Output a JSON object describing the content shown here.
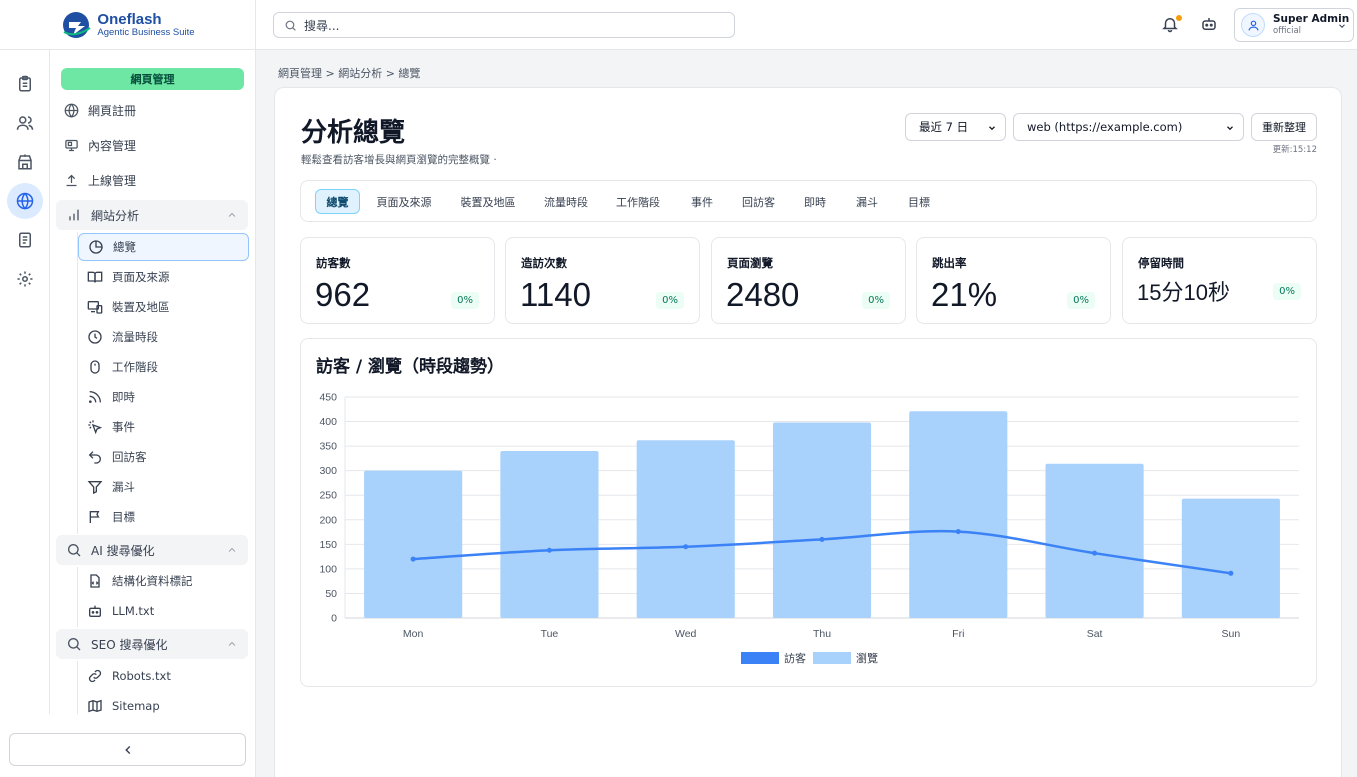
{
  "brand": {
    "name": "Oneflash",
    "tagline": "Agentic Business Suite"
  },
  "header": {
    "search_placeholder": "搜尋...",
    "user_name": "Super Admin",
    "user_role": "official"
  },
  "sidebar": {
    "top_button": "網頁管理",
    "items": [
      {
        "label": "網頁註冊",
        "icon": "globe-icon"
      },
      {
        "label": "內容管理",
        "icon": "monitor-icon"
      },
      {
        "label": "上線管理",
        "icon": "upload-icon"
      }
    ],
    "groups": [
      {
        "label": "網站分析",
        "icon": "bar-chart-icon",
        "children": [
          {
            "label": "總覽",
            "icon": "pie-chart-icon",
            "active": true
          },
          {
            "label": "頁面及來源",
            "icon": "book-icon"
          },
          {
            "label": "裝置及地區",
            "icon": "devices-icon"
          },
          {
            "label": "流量時段",
            "icon": "clock-icon"
          },
          {
            "label": "工作階段",
            "icon": "mouse-icon"
          },
          {
            "label": "即時",
            "icon": "rss-icon"
          },
          {
            "label": "事件",
            "icon": "pointer-icon"
          },
          {
            "label": "回訪客",
            "icon": "undo-icon"
          },
          {
            "label": "漏斗",
            "icon": "funnel-icon"
          },
          {
            "label": "目標",
            "icon": "flag-icon"
          }
        ]
      },
      {
        "label": "AI 搜尋優化",
        "icon": "search-icon",
        "children": [
          {
            "label": "結構化資料標記",
            "icon": "file-code-icon"
          },
          {
            "label": "LLM.txt",
            "icon": "bot-icon"
          }
        ]
      },
      {
        "label": "SEO 搜尋優化",
        "icon": "search-icon",
        "children": [
          {
            "label": "Robots.txt",
            "icon": "link-icon"
          },
          {
            "label": "Sitemap",
            "icon": "map-icon"
          }
        ]
      }
    ]
  },
  "main": {
    "breadcrumb": "網頁管理 > 網站分析 > 總覽",
    "title": "分析總覽",
    "subtitle": "輕鬆查看訪客增長與網頁瀏覽的完整概覽 ·",
    "range_select": "最近 7 日",
    "site_select": "web (https://example.com)",
    "refresh_label": "重新整理",
    "updated": "更新:15:12",
    "tabs": [
      "總覽",
      "頁面及來源",
      "裝置及地區",
      "流量時段",
      "工作階段",
      "事件",
      "回訪客",
      "即時",
      "漏斗",
      "目標"
    ],
    "stats": [
      {
        "label": "訪客數",
        "value": "962",
        "change": "0%"
      },
      {
        "label": "造訪次數",
        "value": "1140",
        "change": "0%"
      },
      {
        "label": "頁面瀏覽",
        "value": "2480",
        "change": "0%"
      },
      {
        "label": "跳出率",
        "value": "21%",
        "change": "0%"
      },
      {
        "label": "停留時間",
        "value": "15分10秒",
        "change": "0%"
      }
    ]
  },
  "chart_data": {
    "type": "bar",
    "title": "訪客 / 瀏覽（時段趨勢）",
    "categories": [
      "Mon",
      "Tue",
      "Wed",
      "Thu",
      "Fri",
      "Sat",
      "Sun"
    ],
    "ylim": [
      0,
      450
    ],
    "yticks": [
      0,
      50,
      100,
      150,
      200,
      250,
      300,
      350,
      400,
      450
    ],
    "grid": true,
    "legend": "bottom",
    "series": [
      {
        "name": "訪客",
        "type": "line",
        "color": "#3b82f6",
        "values": [
          120,
          138,
          145,
          160,
          176,
          132,
          91
        ]
      },
      {
        "name": "瀏覽",
        "type": "bar",
        "color": "#a8d1fb",
        "values": [
          300,
          340,
          362,
          398,
          421,
          314,
          243
        ]
      }
    ]
  }
}
